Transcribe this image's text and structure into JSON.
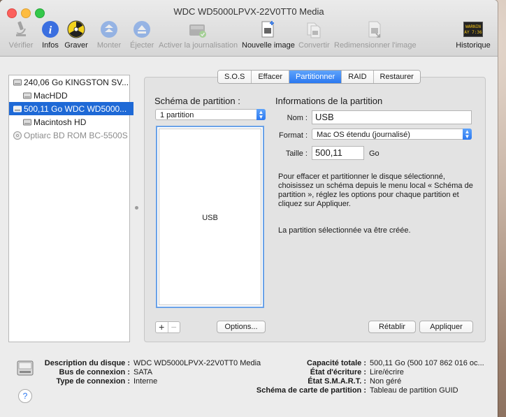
{
  "window": {
    "title": "WDC WD5000LPVX-22V0TT0 Media"
  },
  "toolbar": {
    "items": [
      {
        "label": "Vérifier",
        "icon": "microscope-icon"
      },
      {
        "label": "Infos",
        "icon": "info-icon"
      },
      {
        "label": "Graver",
        "icon": "burn-icon"
      },
      {
        "label": "Monter",
        "icon": "mount-icon"
      },
      {
        "label": "Éjecter",
        "icon": "eject-icon"
      },
      {
        "label": "Activer la journalisation",
        "icon": "journal-icon"
      },
      {
        "label": "Nouvelle image",
        "icon": "new-image-icon"
      },
      {
        "label": "Convertir",
        "icon": "convert-icon"
      },
      {
        "label": "Redimensionner l'image",
        "icon": "resize-image-icon"
      },
      {
        "label": "Historique",
        "icon": "log-icon",
        "badge_line1": "WARNIN",
        "badge_line2": "AY 7:36"
      }
    ]
  },
  "sidebar": {
    "items": [
      {
        "label": "240,06 Go KINGSTON SV..."
      },
      {
        "label": "MacHDD"
      },
      {
        "label": "500,11 Go WDC WD5000..."
      },
      {
        "label": "Macintosh HD"
      },
      {
        "label": "Optiarc BD ROM BC-5500S"
      }
    ]
  },
  "tabs": [
    "S.O.S",
    "Effacer",
    "Partitionner",
    "RAID",
    "Restaurer"
  ],
  "partition": {
    "scheme_title": "Schéma de partition :",
    "scheme_value": "1 partition",
    "box_label": "USB",
    "options_button": "Options...",
    "info_title": "Informations de la partition",
    "name_label": "Nom :",
    "name_value": "USB",
    "format_label": "Format :",
    "format_value": "Mac OS étendu (journalisé)",
    "size_label": "Taille :",
    "size_value": "500,11",
    "size_unit": "Go",
    "help_text_lines": [
      "Pour effacer et partitionner le disque sélectionné,",
      "choisissez un schéma depuis le menu local « Schéma de",
      "partition », réglez les options pour chaque partition et",
      "cliquez sur Appliquer."
    ],
    "status_text": "La partition sélectionnée va être créée.",
    "revert_button": "Rétablir",
    "apply_button": "Appliquer",
    "add_symbol": "+",
    "remove_symbol": "−"
  },
  "disk_info": {
    "left": [
      {
        "label": "Description du disque :",
        "value": "WDC WD5000LPVX-22V0TT0 Media"
      },
      {
        "label": "Bus de connexion :",
        "value": "SATA"
      },
      {
        "label": "Type de connexion :",
        "value": "Interne"
      }
    ],
    "right": [
      {
        "label": "Capacité totale :",
        "value": "500,11 Go (500 107 862 016 oc..."
      },
      {
        "label": "État d'écriture :",
        "value": "Lire/écrire"
      },
      {
        "label": "État S.M.A.R.T. :",
        "value": "Non géré"
      },
      {
        "label": "Schéma de carte de partition :",
        "value": "Tableau de partition GUID"
      }
    ]
  },
  "help": "?"
}
